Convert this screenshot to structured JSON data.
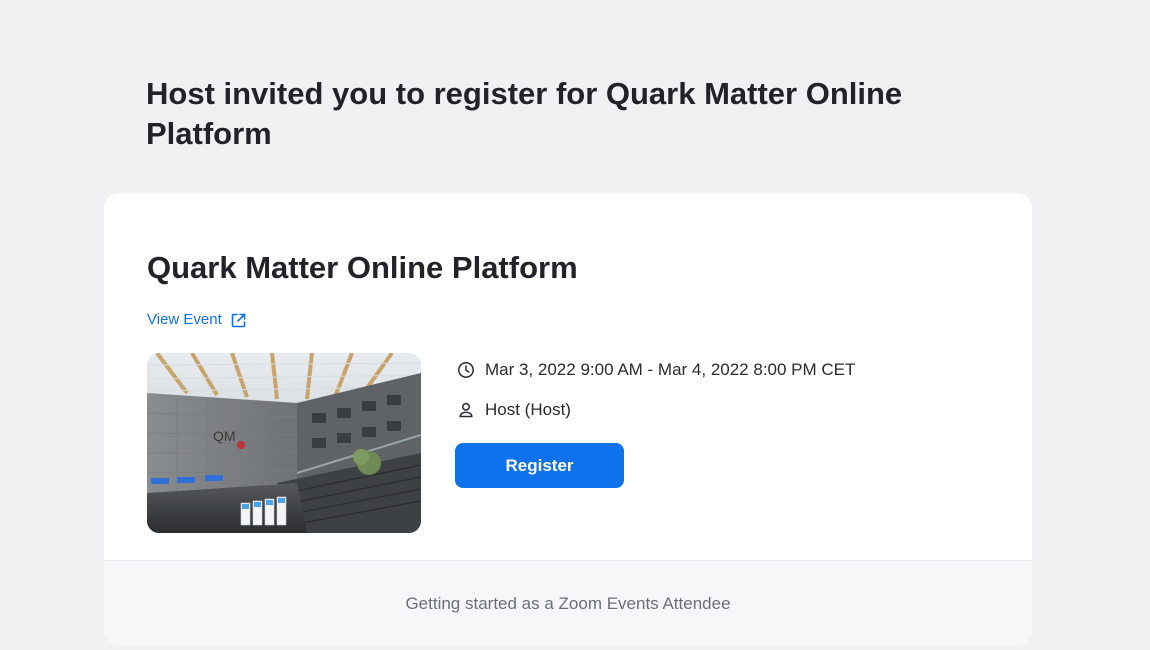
{
  "invite": {
    "heading": "Host invited you to register for Quark Matter Online Platform"
  },
  "event": {
    "title": "Quark Matter Online Platform",
    "view_event_label": "View Event",
    "datetime": "Mar 3, 2022 9:00 AM - Mar 4, 2022 8:00 PM CET",
    "host": "Host (Host)",
    "register_label": "Register"
  },
  "footer": {
    "link_label": "Getting started as a Zoom Events Attendee"
  },
  "icons": {
    "view_event": "external-link-icon",
    "datetime": "clock-icon",
    "host": "person-icon"
  },
  "colors": {
    "accent": "#0e72ed",
    "page_background": "#f1f1f4",
    "card_background": "#ffffff",
    "footer_background": "#f7f7f9",
    "footer_text": "#6e6e78"
  }
}
